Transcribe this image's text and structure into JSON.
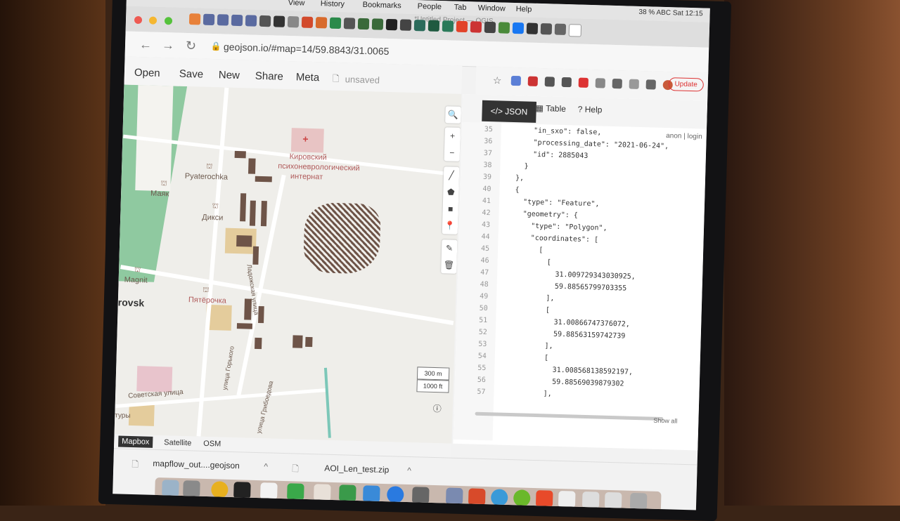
{
  "menubar": {
    "items": [
      "View",
      "History",
      "Bookmarks",
      "People",
      "Tab",
      "Window",
      "Help"
    ],
    "status": "38 %  ABC  Sat 12:15",
    "window_title": "*Untitled Project — QGIS"
  },
  "browser": {
    "url": "geojson.io/#map=14/59.8843/31.0065",
    "update_label": "Update"
  },
  "app_menu": {
    "open": "Open",
    "save": "Save",
    "new": "New",
    "share": "Share",
    "meta": "Meta",
    "unsaved": "unsaved"
  },
  "map": {
    "labels": {
      "kirovsky": "Кировский",
      "psycho": "психоневрологический",
      "internat": "интернат",
      "pyaterochka": "Pyaterochka",
      "mayak": "Маяк",
      "diksi": "Дикси",
      "magnit": "Magnit",
      "pyaterochka_ru": "Пятёрочка",
      "city": "rovsk",
      "street": "Советская улица",
      "ladozhskaya": "Ладожская улица",
      "gorky": "улица Горького",
      "griboedova": "улица Грибоедова",
      "tury": "туры"
    },
    "scale_metric": "300 m",
    "scale_imperial": "1000 ft",
    "layers": [
      "Mapbox",
      "Satellite",
      "OSM"
    ],
    "active_layer": "Mapbox"
  },
  "editor": {
    "tabs": {
      "json": "JSON",
      "table": "Table",
      "help": "Help"
    },
    "login": "anon | login",
    "show_all": "Show all",
    "lines": [
      {
        "n": "35",
        "t": "        \"in_sxo\": false,"
      },
      {
        "n": "36",
        "t": "        \"processing_date\": \"2021-06-24\","
      },
      {
        "n": "37",
        "t": "        \"id\": 2885043"
      },
      {
        "n": "38",
        "t": "      }"
      },
      {
        "n": "39",
        "t": "    },"
      },
      {
        "n": "40",
        "t": "    {"
      },
      {
        "n": "41",
        "t": "      \"type\": \"Feature\","
      },
      {
        "n": "42",
        "t": "      \"geometry\": {"
      },
      {
        "n": "43",
        "t": "        \"type\": \"Polygon\","
      },
      {
        "n": "44",
        "t": "        \"coordinates\": ["
      },
      {
        "n": "45",
        "t": "          ["
      },
      {
        "n": "46",
        "t": "            ["
      },
      {
        "n": "47",
        "t": "              31.009729343030925,"
      },
      {
        "n": "48",
        "t": "              59.88565799703355"
      },
      {
        "n": "49",
        "t": "            ],"
      },
      {
        "n": "50",
        "t": "            ["
      },
      {
        "n": "51",
        "t": "              31.00866747376072,"
      },
      {
        "n": "52",
        "t": "              59.88563159742739"
      },
      {
        "n": "53",
        "t": "            ],"
      },
      {
        "n": "54",
        "t": "            ["
      },
      {
        "n": "55",
        "t": "              31.008568138592197,"
      },
      {
        "n": "56",
        "t": "              59.88569039879302"
      },
      {
        "n": "57",
        "t": "            ],"
      }
    ]
  },
  "downloads": {
    "file1": "mapflow_out....geojson",
    "file2": "AOI_Len_test.zip"
  }
}
